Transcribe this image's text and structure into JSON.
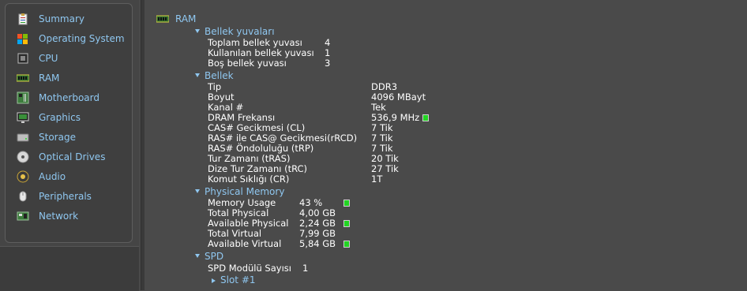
{
  "sidebar": {
    "items": [
      {
        "label": "Summary",
        "icon": "clipboard-icon"
      },
      {
        "label": "Operating System",
        "icon": "windows-logo-icon"
      },
      {
        "label": "CPU",
        "icon": "cpu-chip-icon"
      },
      {
        "label": "RAM",
        "icon": "ram-module-icon"
      },
      {
        "label": "Motherboard",
        "icon": "motherboard-icon"
      },
      {
        "label": "Graphics",
        "icon": "monitor-icon"
      },
      {
        "label": "Storage",
        "icon": "hard-drive-icon"
      },
      {
        "label": "Optical Drives",
        "icon": "optical-disc-icon"
      },
      {
        "label": "Audio",
        "icon": "speaker-icon"
      },
      {
        "label": "Peripherals",
        "icon": "mouse-icon"
      },
      {
        "label": "Network",
        "icon": "network-card-icon"
      }
    ]
  },
  "main": {
    "title": "RAM",
    "slots": {
      "title": "Bellek yuvaları",
      "rows": [
        {
          "label": "Toplam bellek yuvası",
          "value": "4"
        },
        {
          "label": "Kullanılan bellek yuvası",
          "value": "1"
        },
        {
          "label": "Boş bellek yuvası",
          "value": "3"
        }
      ]
    },
    "memory": {
      "title": "Bellek",
      "rows": [
        {
          "label": "Tip",
          "value": "DDR3"
        },
        {
          "label": "Boyut",
          "value": "4096 MBayt"
        },
        {
          "label": "Kanal #",
          "value": "Tek"
        },
        {
          "label": "DRAM Frekansı",
          "value": "536,9 MHz"
        },
        {
          "label": "CAS# Gecikmesi (CL)",
          "value": "7 Tik"
        },
        {
          "label": "RAS# ile CAS@ Gecikmesi(rRCD)",
          "value": "7 Tik"
        },
        {
          "label": "RAS# Öndoluluğu (tRP)",
          "value": "7 Tik"
        },
        {
          "label": "Tur Zamanı (tRAS)",
          "value": "20 Tik"
        },
        {
          "label": "Dize Tur Zamanı (tRC)",
          "value": "27 Tik"
        },
        {
          "label": "Komut Sıklığı (CR)",
          "value": "1T"
        }
      ]
    },
    "physical": {
      "title": "Physical Memory",
      "rows": [
        {
          "label": "Memory Usage",
          "value": "43 %"
        },
        {
          "label": "Total Physical",
          "value": "4,00 GB"
        },
        {
          "label": "Available Physical",
          "value": "2,24 GB"
        },
        {
          "label": "Total Virtual",
          "value": "7,99 GB"
        },
        {
          "label": "Available Virtual",
          "value": "5,84 GB"
        }
      ]
    },
    "spd": {
      "title": "SPD",
      "rows": [
        {
          "label": "SPD Modülü Sayısı",
          "value": "1"
        }
      ],
      "slot": "Slot #1"
    }
  },
  "colors": {
    "accent": "#8fc7f0",
    "background": "#4a4a4a",
    "indicator": "#22d422"
  }
}
